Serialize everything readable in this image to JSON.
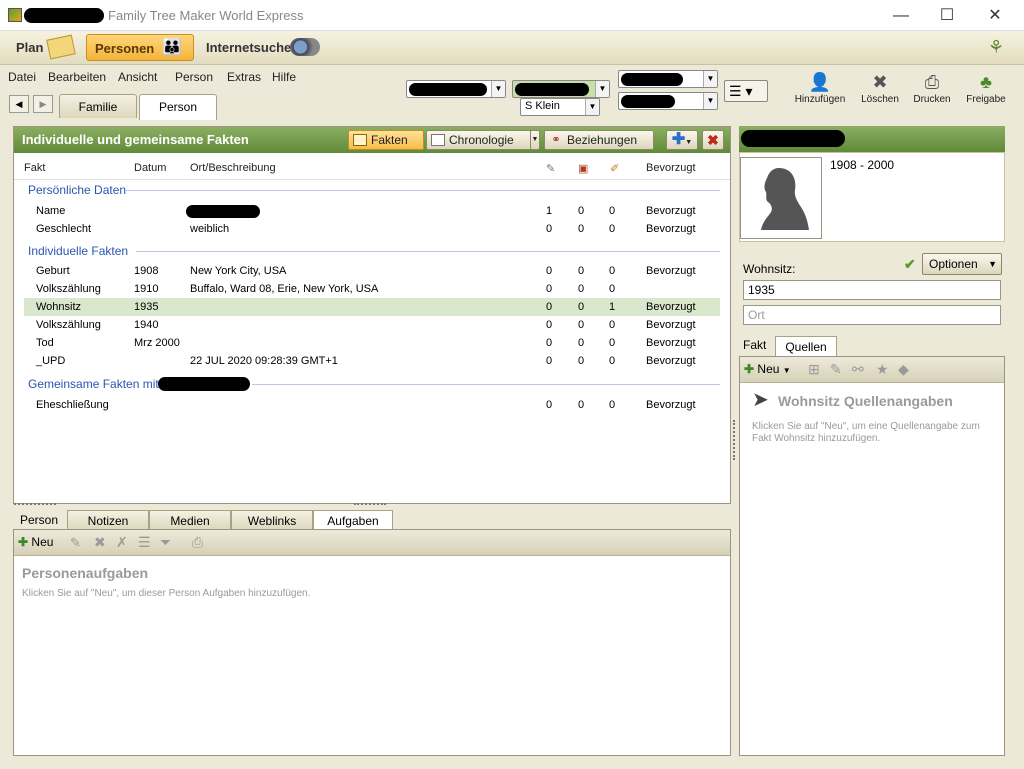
{
  "window": {
    "title": "Family Tree Maker World Express",
    "minimize": "—",
    "maximize": "☐",
    "close": "✕"
  },
  "nav": {
    "plan": "Plan",
    "personen": "Personen",
    "internetsuche": "Internetsuche"
  },
  "menu": [
    "Datei",
    "Bearbeiten",
    "Ansicht",
    "Person",
    "Extras",
    "Hilfe"
  ],
  "subtabs": {
    "familie": "Familie",
    "person": "Person"
  },
  "selectors": {
    "spouse": "S Klein"
  },
  "toolbar": {
    "add": "Hinzufügen",
    "delete": "Löschen",
    "print": "Drucken",
    "share": "Freigabe"
  },
  "facts": {
    "title": "Individuelle und gemeinsame Fakten",
    "btn_facts": "Fakten",
    "btn_chronology": "Chronologie",
    "btn_relations": "Beziehungen",
    "columns": {
      "fact": "Fakt",
      "date": "Datum",
      "place": "Ort/Beschreibung",
      "preferred": "Bevorzugt"
    },
    "section_personal": "Persönliche Daten",
    "section_individual": "Individuelle Fakten",
    "section_shared": "Gemeinsame Fakten mit",
    "rows": [
      {
        "fact": "Name",
        "date": "",
        "place": "",
        "s": "1",
        "m": "0",
        "n": "0",
        "pref": "Bevorzugt"
      },
      {
        "fact": "Geschlecht",
        "date": "",
        "place": "weiblich",
        "s": "0",
        "m": "0",
        "n": "0",
        "pref": "Bevorzugt"
      },
      {
        "fact": "Geburt",
        "date": "1908",
        "place": "New York City, USA",
        "s": "0",
        "m": "0",
        "n": "0",
        "pref": "Bevorzugt"
      },
      {
        "fact": "Volkszählung",
        "date": "1910",
        "place": "Buffalo, Ward 08, Erie, New York, USA",
        "s": "0",
        "m": "0",
        "n": "0",
        "pref": ""
      },
      {
        "fact": "Wohnsitz",
        "date": "1935",
        "place": "",
        "s": "0",
        "m": "0",
        "n": "1",
        "pref": "Bevorzugt"
      },
      {
        "fact": "Volkszählung",
        "date": "1940",
        "place": "",
        "s": "0",
        "m": "0",
        "n": "0",
        "pref": "Bevorzugt"
      },
      {
        "fact": "Tod",
        "date": "Mrz 2000",
        "place": "",
        "s": "0",
        "m": "0",
        "n": "0",
        "pref": "Bevorzugt"
      },
      {
        "fact": "_UPD",
        "date": "",
        "place": "22 JUL 2020 09:28:39 GMT+1",
        "s": "0",
        "m": "0",
        "n": "0",
        "pref": "Bevorzugt"
      },
      {
        "fact": "Eheschließung",
        "date": "",
        "place": "",
        "s": "0",
        "m": "0",
        "n": "0",
        "pref": "Bevorzugt"
      }
    ]
  },
  "bottom_tabs": [
    "Person",
    "Notizen",
    "Medien",
    "Weblinks",
    "Aufgaben"
  ],
  "tasks": {
    "new": "Neu",
    "title": "Personenaufgaben",
    "hint": "Klicken Sie auf \"Neu\", um dieser Person Aufgaben hinzuzufügen."
  },
  "person": {
    "years": "1908 - 2000"
  },
  "detail": {
    "label": "Wohnsitz:",
    "options": "Optionen",
    "date_value": "1935",
    "place_placeholder": "Ort",
    "tab_fact": "Fakt",
    "tab_sources": "Quellen",
    "new": "Neu",
    "sources_title": "Wohnsitz Quellenangaben",
    "sources_hint": "Klicken Sie auf \"Neu\", um eine Quellenangabe zum Fakt Wohnsitz hinzuzufügen."
  }
}
